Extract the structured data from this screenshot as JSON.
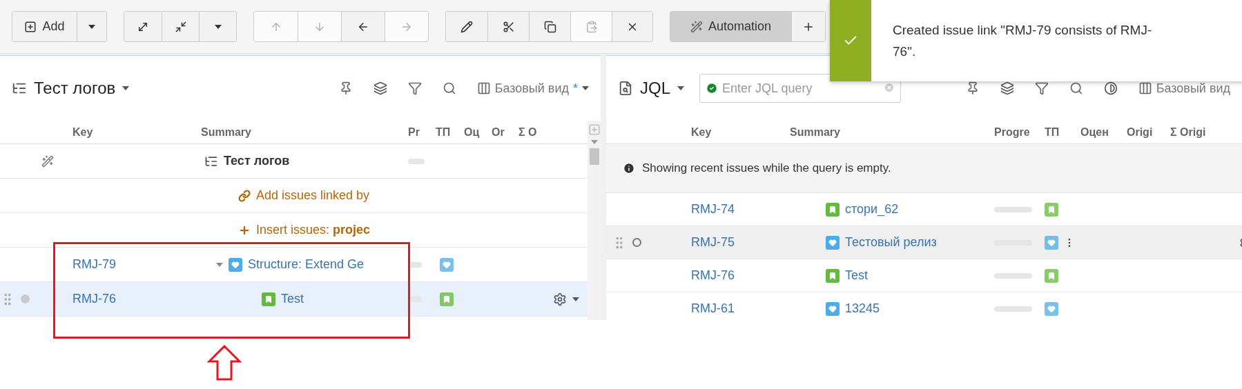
{
  "toolbar": {
    "groups": [
      {
        "buttons": [
          {
            "kind": "add",
            "label": "Add",
            "disabled": false,
            "selected": false
          },
          {
            "kind": "caret",
            "disabled": false,
            "selected": false
          }
        ]
      },
      {
        "buttons": [
          {
            "kind": "expand",
            "disabled": false,
            "selected": false
          },
          {
            "kind": "collapse",
            "disabled": false,
            "selected": false
          },
          {
            "kind": "caret",
            "disabled": false,
            "selected": false
          }
        ]
      },
      {
        "buttons": [
          {
            "kind": "up",
            "disabled": true,
            "selected": false
          },
          {
            "kind": "down",
            "disabled": true,
            "selected": false
          },
          {
            "kind": "left",
            "disabled": false,
            "selected": false
          },
          {
            "kind": "right",
            "disabled": true,
            "selected": false
          }
        ]
      },
      {
        "buttons": [
          {
            "kind": "edit",
            "disabled": false,
            "selected": false
          },
          {
            "kind": "cut",
            "disabled": false,
            "selected": false
          },
          {
            "kind": "copy",
            "disabled": false,
            "selected": false
          },
          {
            "kind": "paste",
            "disabled": true,
            "selected": false
          },
          {
            "kind": "delete",
            "disabled": false,
            "selected": false
          }
        ]
      },
      {
        "buttons": [
          {
            "kind": "automation",
            "label": "Automation",
            "disabled": false,
            "selected": true
          },
          {
            "kind": "plus",
            "disabled": false,
            "selected": false
          }
        ]
      }
    ]
  },
  "notification": {
    "message": "Created issue link \"RMJ-79 consists of RMJ-76\"."
  },
  "structure_panel": {
    "title": "Тест логов",
    "view": "Базовый вид",
    "view_mark": "*",
    "columns": [
      {
        "label": "Key"
      },
      {
        "label": "Summary"
      },
      {
        "label": "Pr"
      },
      {
        "label": "ТП"
      },
      {
        "label": "Оц"
      },
      {
        "label": "Or"
      },
      {
        "label": "Σ O"
      }
    ],
    "rows": [
      {
        "kind": "root",
        "summary": "Тест логов",
        "level": 0
      },
      {
        "kind": "linked",
        "text": "Add issues linked by"
      },
      {
        "kind": "insert",
        "text": "Insert issues: **projec**"
      },
      {
        "kind": "improvement",
        "key": "RMJ-79",
        "summary": "Structure: Extend Ge",
        "expanded": true,
        "selected": false,
        "level": 0,
        "children": [
          {
            "kind": "story",
            "key": "RMJ-76",
            "summary": "Test",
            "selected": true,
            "level": 0
          }
        ]
      }
    ]
  },
  "jql_panel": {
    "title": "JQL",
    "query": {
      "placeholder": "Enter JQL query"
    },
    "view": "Базовый вид",
    "columns": [
      {
        "label": "Key"
      },
      {
        "label": "Summary"
      },
      {
        "label": "Progre"
      },
      {
        "label": "ТП"
      },
      {
        "label": "Оцен"
      },
      {
        "label": "Origi"
      },
      {
        "label": "Σ Origi"
      }
    ],
    "notice": "Showing recent issues while the query is empty.",
    "rows": [
      {
        "kind": "story",
        "key": "RMJ-74",
        "summary": "стори_62",
        "highlighted": false,
        "level": 0
      },
      {
        "kind": "improvement",
        "key": "RMJ-75",
        "summary": "Тестовый релиз",
        "highlighted": true,
        "level": 0
      },
      {
        "kind": "story",
        "key": "RMJ-76",
        "summary": "Test",
        "highlighted": false,
        "level": 0
      },
      {
        "kind": "improvement",
        "key": "RMJ-61",
        "summary": "13245",
        "highlighted": false,
        "level": 0
      }
    ]
  }
}
